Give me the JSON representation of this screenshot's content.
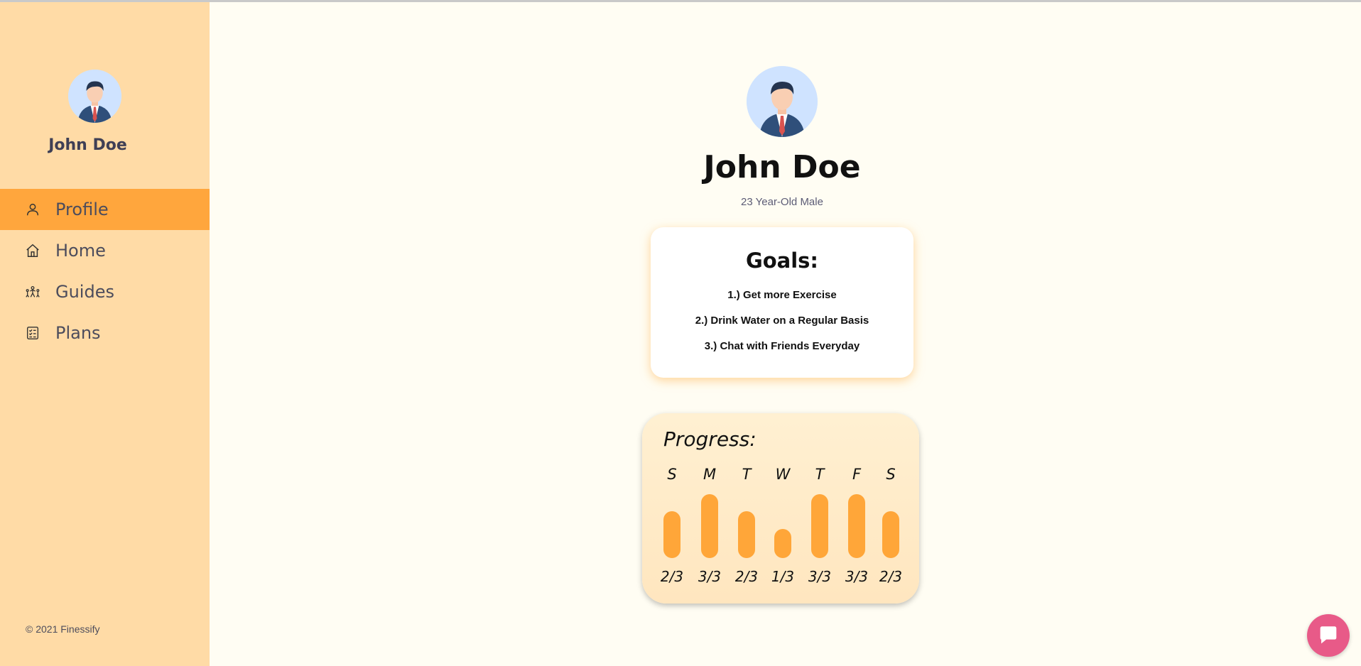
{
  "colors": {
    "sidebar_bg": "#ffdba6",
    "active_nav": "#ffa63d",
    "page_bg": "#fffdf3",
    "bar": "#ffa639",
    "chat": "#e85a88"
  },
  "sidebar": {
    "user_name": "John Doe",
    "avatar_icon": "user-avatar-icon",
    "items": [
      {
        "label": "Profile",
        "icon": "user-icon",
        "active": true
      },
      {
        "label": "Home",
        "icon": "home-icon",
        "active": false
      },
      {
        "label": "Guides",
        "icon": "guides-icon",
        "active": false
      },
      {
        "label": "Plans",
        "icon": "plans-icon",
        "active": false
      }
    ],
    "copyright": "© 2021 Finessify"
  },
  "profile": {
    "name": "John Doe",
    "subtitle": "23 Year-Old Male"
  },
  "goals": {
    "title": "Goals:",
    "items": [
      "1.) Get more Exercise",
      "2.) Drink Water on a Regular Basis",
      "3.) Chat with Friends Everyday"
    ]
  },
  "progress": {
    "title": "Progress:",
    "days": [
      {
        "day": "S",
        "score": "2/3",
        "fraction": 0.67
      },
      {
        "day": "M",
        "score": "3/3",
        "fraction": 1.0
      },
      {
        "day": "T",
        "score": "2/3",
        "fraction": 0.67
      },
      {
        "day": "W",
        "score": "1/3",
        "fraction": 0.33
      },
      {
        "day": "T",
        "score": "3/3",
        "fraction": 1.0
      },
      {
        "day": "F",
        "score": "3/3",
        "fraction": 1.0
      },
      {
        "day": "S",
        "score": "2/3",
        "fraction": 0.67
      }
    ]
  },
  "chat": {
    "icon": "chat-bubble-icon"
  }
}
